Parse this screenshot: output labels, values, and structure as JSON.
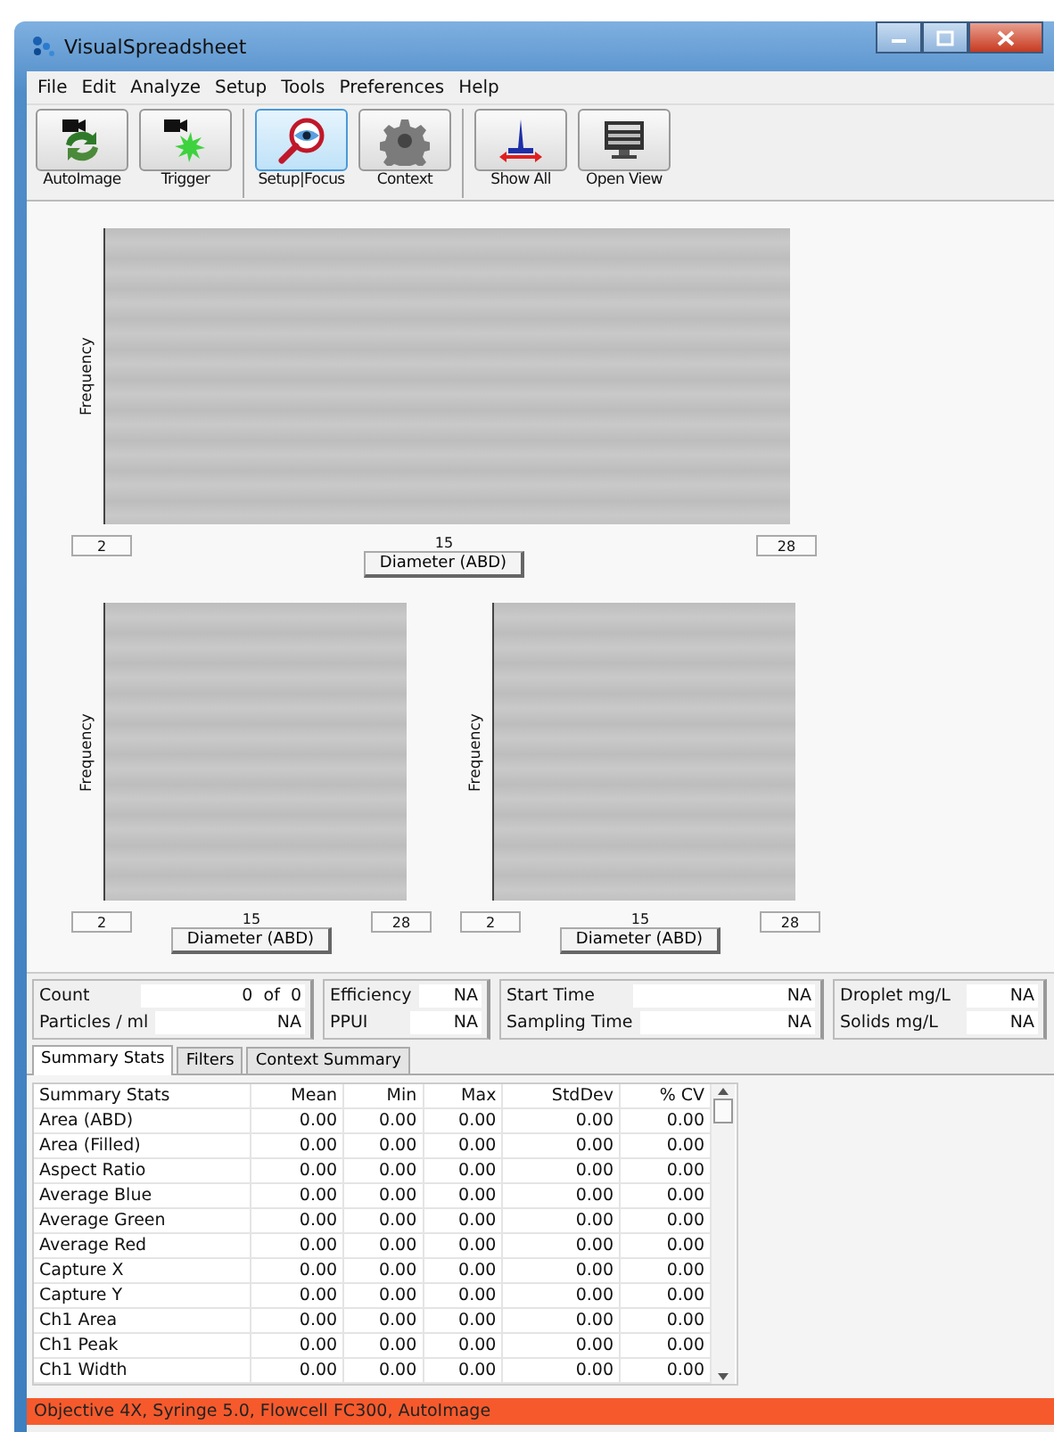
{
  "window": {
    "title": "VisualSpreadsheet"
  },
  "menu": [
    "File",
    "Edit",
    "Analyze",
    "Setup",
    "Tools",
    "Preferences",
    "Help"
  ],
  "toolbar": [
    [
      {
        "label": "AutoImage",
        "selected": false
      },
      {
        "label": "Trigger",
        "selected": false
      }
    ],
    [
      {
        "label": "Setup|Focus",
        "selected": true
      },
      {
        "label": "Context",
        "selected": false
      }
    ],
    [
      {
        "label": "Show All",
        "selected": false
      },
      {
        "label": "Open View",
        "selected": false
      }
    ]
  ],
  "plots": [
    {
      "y_label": "Frequency",
      "min": "2",
      "mid": "15",
      "max": "28",
      "axis_label": "Diameter (ABD)"
    },
    {
      "y_label": "Frequency",
      "min": "2",
      "mid": "15",
      "max": "28",
      "axis_label": "Diameter (ABD)"
    },
    {
      "y_label": "Frequency",
      "min": "2",
      "mid": "15",
      "max": "28",
      "axis_label": "Diameter (ABD)"
    }
  ],
  "stats": [
    [
      {
        "label": "Count",
        "value": "0  of  0"
      },
      {
        "label": "Particles / ml",
        "value": "NA"
      }
    ],
    [
      {
        "label": "Efficiency",
        "value": "NA"
      },
      {
        "label": "PPUI",
        "value": "NA"
      }
    ],
    [
      {
        "label": "Start Time",
        "value": "NA"
      },
      {
        "label": "Sampling Time",
        "value": "NA"
      }
    ],
    [
      {
        "label": "Droplet mg/L",
        "value": "NA"
      },
      {
        "label": "Solids mg/L",
        "value": "NA"
      }
    ]
  ],
  "tabs": [
    {
      "label": "Summary Stats",
      "selected": true
    },
    {
      "label": "Filters",
      "selected": false
    },
    {
      "label": "Context Summary",
      "selected": false
    }
  ],
  "table": {
    "columns": [
      "Summary Stats",
      "Mean",
      "Min",
      "Max",
      "StdDev",
      "% CV"
    ],
    "rows": [
      [
        "Area (ABD)",
        "0.00",
        "0.00",
        "0.00",
        "0.00",
        "0.00"
      ],
      [
        "Area (Filled)",
        "0.00",
        "0.00",
        "0.00",
        "0.00",
        "0.00"
      ],
      [
        "Aspect Ratio",
        "0.00",
        "0.00",
        "0.00",
        "0.00",
        "0.00"
      ],
      [
        "Average Blue",
        "0.00",
        "0.00",
        "0.00",
        "0.00",
        "0.00"
      ],
      [
        "Average Green",
        "0.00",
        "0.00",
        "0.00",
        "0.00",
        "0.00"
      ],
      [
        "Average Red",
        "0.00",
        "0.00",
        "0.00",
        "0.00",
        "0.00"
      ],
      [
        "Capture X",
        "0.00",
        "0.00",
        "0.00",
        "0.00",
        "0.00"
      ],
      [
        "Capture Y",
        "0.00",
        "0.00",
        "0.00",
        "0.00",
        "0.00"
      ],
      [
        "Ch1 Area",
        "0.00",
        "0.00",
        "0.00",
        "0.00",
        "0.00"
      ],
      [
        "Ch1 Peak",
        "0.00",
        "0.00",
        "0.00",
        "0.00",
        "0.00"
      ],
      [
        "Ch1 Width",
        "0.00",
        "0.00",
        "0.00",
        "0.00",
        "0.00"
      ]
    ]
  },
  "status_bar": "Objective 4X,  Syringe 5.0,  Flowcell FC300,  AutoImage"
}
